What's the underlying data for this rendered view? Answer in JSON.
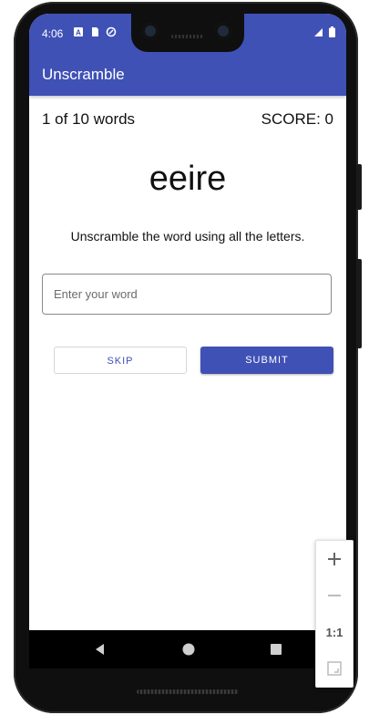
{
  "status_bar": {
    "time": "4:06",
    "icons": [
      "a-icon",
      "sd-card-icon",
      "sync-icon"
    ],
    "right_icons": [
      "signal-icon",
      "battery-icon"
    ]
  },
  "app_bar": {
    "title": "Unscramble",
    "color": "#3f51b5"
  },
  "game": {
    "word_count": "1 of 10 words",
    "score": "SCORE: 0",
    "scrambled_word": "eeire",
    "instructions": "Unscramble the word using all the letters.",
    "input": {
      "value": "",
      "placeholder": "Enter your word"
    },
    "skip_label": "SKIP",
    "submit_label": "SUBMIT"
  },
  "nav_bar": {
    "items": [
      "back-icon",
      "home-icon",
      "recents-icon"
    ]
  },
  "zoom_controls": {
    "zoom_in_icon": "plus-icon",
    "zoom_out_icon": "minus-icon",
    "actual_size_label": "1:1",
    "fit_icon": "fit-screen-icon"
  }
}
